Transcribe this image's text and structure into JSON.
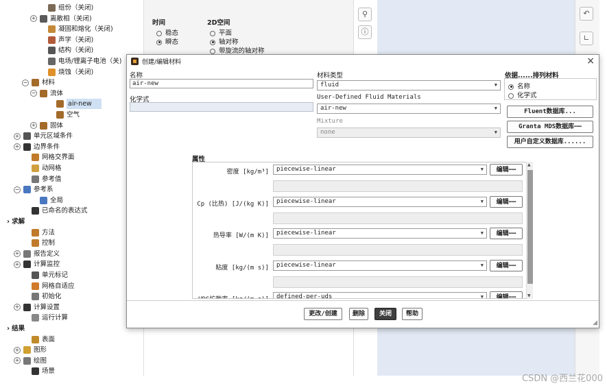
{
  "tree": {
    "rows": [
      {
        "label": "组份（关闭)",
        "indent": 3,
        "expander": "",
        "icon": "component-icon",
        "color": "#7a6a55"
      },
      {
        "label": "离散相（关闭)",
        "indent": 2,
        "expander": "+",
        "icon": "dpm-icon",
        "color": "#5a5a5a"
      },
      {
        "label": "凝固和熔化（关闭)",
        "indent": 3,
        "expander": "",
        "icon": "solidification-icon",
        "color": "#c48a3a"
      },
      {
        "label": "声学（关闭)",
        "indent": 3,
        "expander": "",
        "icon": "acoustics-icon",
        "color": "#b35a3a"
      },
      {
        "label": "结构（关闭)",
        "indent": 3,
        "expander": "",
        "icon": "structure-icon",
        "color": "#555"
      },
      {
        "label": "电场/锂离子电池（关)",
        "indent": 3,
        "expander": "",
        "icon": "battery-icon",
        "color": "#666"
      },
      {
        "label": "烧蚀（关闭)",
        "indent": 3,
        "expander": "",
        "icon": "ablation-icon",
        "color": "#e0902a"
      },
      {
        "label": "材料",
        "indent": 1,
        "expander": "−",
        "icon": "materials-icon",
        "color": "#a36a2a"
      },
      {
        "label": "流体",
        "indent": 2,
        "expander": "−",
        "icon": "fluid-icon",
        "color": "#a36a2a"
      },
      {
        "label": "air-new",
        "indent": 4,
        "expander": "",
        "icon": "material-item-icon",
        "color": "#a36a2a",
        "selected": true
      },
      {
        "label": "空气",
        "indent": 4,
        "expander": "",
        "icon": "material-item-icon",
        "color": "#a36a2a"
      },
      {
        "label": "固体",
        "indent": 2,
        "expander": "+",
        "icon": "solid-icon",
        "color": "#a36a2a"
      },
      {
        "label": "单元区域条件",
        "indent": 0,
        "expander": "+",
        "icon": "cell-zone-icon",
        "color": "#555"
      },
      {
        "label": "边界条件",
        "indent": 0,
        "expander": "+",
        "icon": "boundary-icon",
        "color": "#333"
      },
      {
        "label": "网格交界面",
        "indent": 1,
        "expander": "",
        "icon": "interface-icon",
        "color": "#c07a2a"
      },
      {
        "label": "动网格",
        "indent": 1,
        "expander": "",
        "icon": "dynamic-mesh-icon",
        "color": "#d0a040"
      },
      {
        "label": "参考值",
        "indent": 1,
        "expander": "",
        "icon": "reference-values-icon",
        "color": "#777"
      },
      {
        "label": "参考系",
        "indent": 0,
        "expander": "−",
        "icon": "reference-frame-icon",
        "color": "#4a78c0"
      },
      {
        "label": "全局",
        "indent": 2,
        "expander": "",
        "icon": "global-frame-icon",
        "color": "#4a78c0"
      },
      {
        "label": "已命名的表达式",
        "indent": 1,
        "expander": "",
        "icon": "function-icon",
        "color": "#333"
      },
      {
        "label": "求解",
        "indent": -1,
        "expander": "",
        "icon": "",
        "color": "",
        "section": true
      },
      {
        "label": "方法",
        "indent": 1,
        "expander": "",
        "icon": "methods-icon",
        "color": "#c07a2a"
      },
      {
        "label": "控制",
        "indent": 1,
        "expander": "",
        "icon": "controls-icon",
        "color": "#c07a2a"
      },
      {
        "label": "报告定义",
        "indent": 0,
        "expander": "+",
        "icon": "report-icon",
        "color": "#777"
      },
      {
        "label": "计算监控",
        "indent": 0,
        "expander": "+",
        "icon": "monitor-icon",
        "color": "#333"
      },
      {
        "label": "单元标记",
        "indent": 1,
        "expander": "",
        "icon": "cell-register-icon",
        "color": "#555"
      },
      {
        "label": "网格自适应",
        "indent": 1,
        "expander": "",
        "icon": "adaption-icon",
        "color": "#d07a2a"
      },
      {
        "label": "初始化",
        "indent": 1,
        "expander": "",
        "icon": "initialize-icon",
        "color": "#777"
      },
      {
        "label": "计算设置",
        "indent": 0,
        "expander": "+",
        "icon": "calc-settings-icon",
        "color": "#333"
      },
      {
        "label": "运行计算",
        "indent": 1,
        "expander": "",
        "icon": "run-icon",
        "color": "#888"
      },
      {
        "label": "结果",
        "indent": -1,
        "expander": "",
        "icon": "",
        "color": "",
        "section": true
      },
      {
        "label": "表面",
        "indent": 1,
        "expander": "",
        "icon": "surface-icon",
        "color": "#c08a2a"
      },
      {
        "label": "图形",
        "indent": 0,
        "expander": "+",
        "icon": "graphics-icon",
        "color": "#d0a030"
      },
      {
        "label": "绘图",
        "indent": 0,
        "expander": "+",
        "icon": "plots-icon",
        "color": "#777"
      },
      {
        "label": "场景",
        "indent": 1,
        "expander": "",
        "icon": "scene-icon",
        "color": "#333"
      }
    ]
  },
  "general_panel": {
    "time_label": "时间",
    "time_options": [
      {
        "label": "稳态",
        "selected": false
      },
      {
        "label": "瞬态",
        "selected": true
      }
    ],
    "space_label": "2D空间",
    "space_options": [
      {
        "label": "平面",
        "selected": false
      },
      {
        "label": "轴对称",
        "selected": true
      },
      {
        "label": "带旋流的轴对称",
        "selected": false
      }
    ]
  },
  "dialog": {
    "title": "创建/编辑材料",
    "name_label": "名称",
    "name_value": "air-new",
    "formula_label": "化学式",
    "formula_value": "",
    "material_type_label": "材料类型",
    "material_type_value": "fluid",
    "udf_label": "User-Defined Fluid Materials",
    "udf_value": "air-new",
    "mixture_label": "Mixture",
    "mixture_value": "none",
    "order_label": "依据......排列材料",
    "order_options": [
      {
        "label": "名称",
        "selected": true
      },
      {
        "label": "化学式",
        "selected": false
      }
    ],
    "db_buttons": [
      "Fluent数据库...",
      "Granta MDS数据库⋯⋯",
      "用户自定义数据库......"
    ],
    "properties_label": "属性",
    "properties": [
      {
        "label": "密度 [kg/m³]",
        "method": "piecewise-linear",
        "edit": "编辑⋯⋯"
      },
      {
        "label": "Cp (比热) [J/(kg K)]",
        "method": "piecewise-linear",
        "edit": "编辑⋯⋯"
      },
      {
        "label": "热导率 [W/(m K)]",
        "method": "piecewise-linear",
        "edit": "编辑⋯⋯"
      },
      {
        "label": "粘度 [kg/(m s)]",
        "method": "piecewise-linear",
        "edit": "编辑⋯⋯"
      },
      {
        "label": "UDS扩散率 [kg/(m s)]",
        "method": "defined-per-uds",
        "edit": "编辑⋯⋯"
      }
    ],
    "footer_buttons": {
      "change": "更改/创建",
      "delete": "删除",
      "close": "关闭",
      "help": "帮助"
    }
  },
  "watermark": "CSDN @西兰花000"
}
